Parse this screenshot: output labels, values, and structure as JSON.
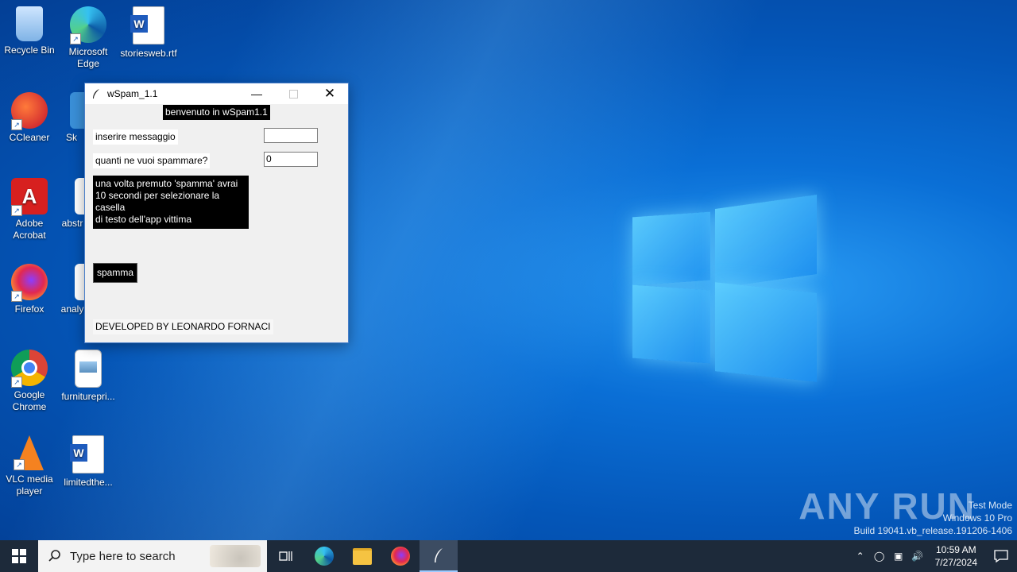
{
  "desktop": {
    "icons": [
      {
        "label": "Recycle Bin"
      },
      {
        "label": "Microsoft Edge"
      },
      {
        "label": "storiesweb.rtf"
      },
      {
        "label": "CCleaner"
      },
      {
        "label": "Sk"
      },
      {
        "label": "Adobe Acrobat"
      },
      {
        "label": "abstr"
      },
      {
        "label": "Firefox"
      },
      {
        "label": "analy"
      },
      {
        "label": "Google Chrome"
      },
      {
        "label": "furniturepri..."
      },
      {
        "label": "VLC media player"
      },
      {
        "label": "limitedthe..."
      }
    ]
  },
  "window": {
    "title": "wSpam_1.1",
    "welcome": "benvenuto in wSpam1.1",
    "message_label": "inserire messaggio",
    "message_value": "",
    "count_label": "quanti ne vuoi spammare?",
    "count_value": "0",
    "info_line1": "una volta premuto 'spamma' avrai",
    "info_line2": "10 secondi per selezionare la casella",
    "info_line3": "di testo dell'app vittima",
    "spam_button": "spamma",
    "footer": "DEVELOPED BY LEONARDO FORNACI"
  },
  "watermark": {
    "brand": "ANY RUN",
    "line1": "Test Mode",
    "line2": "Windows 10 Pro",
    "line3": "Build 19041.vb_release.191206-1406"
  },
  "taskbar": {
    "search_placeholder": "Type here to search",
    "time": "10:59 AM",
    "date": "7/27/2024"
  },
  "colors": {
    "accent": "#0a6fd6",
    "taskbar": "#1d2a3a"
  }
}
